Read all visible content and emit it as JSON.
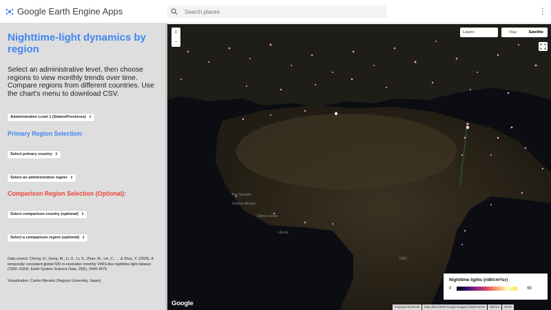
{
  "brand": {
    "name": "Google Earth Engine Apps"
  },
  "search": {
    "placeholder": "Search places"
  },
  "sidebar": {
    "title": "Nighttime-light dynamics by region",
    "description": "Select an administrative level, then choose regions to view monthly trends over time. Compare regions from different countries. Use the chart's menu to download CSV.",
    "admin_level": "Administrative Level 1 (States/Provinces)",
    "primary_heading": "Primary Region Selection:",
    "primary_country": "Select primary country",
    "primary_region": "Select an administrative region",
    "comparison_heading": "Comparison Region Selection (Optional):",
    "comparison_country": "Select comparison country (optional)",
    "comparison_region": "Select a comparison region (optional)",
    "data_source": "Data source: Cheng, H., Geng, M., Li, X., Li, S., Zhao, M., Lin, C., ... & Zhou, Y. (2026). A temporally consistent global 500 m-resolution monthly VIIRS-like nighttime light dataset (1992–2024). Earth System Science Data, 18(5), 3449-3479.",
    "visualization": "Visualization: Carlos Mendez (Nagoya University, Japan)"
  },
  "map": {
    "zoom_in": "+",
    "zoom_out": "−",
    "layers": "Layers",
    "map_button": "Map",
    "satellite_button": "Satellite",
    "legend_title": "Nighttime lights (nW/cm²/sr)",
    "legend_min": "0",
    "legend_max": "60",
    "google_logo": "Google",
    "attrib_shortcuts": "Keyboard shortcuts",
    "attrib_data": "Map data ©2026 Google Imagery ©2026 NASA",
    "attrib_scale": "500 km",
    "attrib_terms": "Terms",
    "places": [
      "The Gambia",
      "Guinea-Bissau",
      "Sierra Leone",
      "Liberia",
      "DRC"
    ],
    "colors": {
      "ocean": "#0d0f14",
      "land": "#2a2419",
      "lights": "#ff7ad9"
    }
  }
}
